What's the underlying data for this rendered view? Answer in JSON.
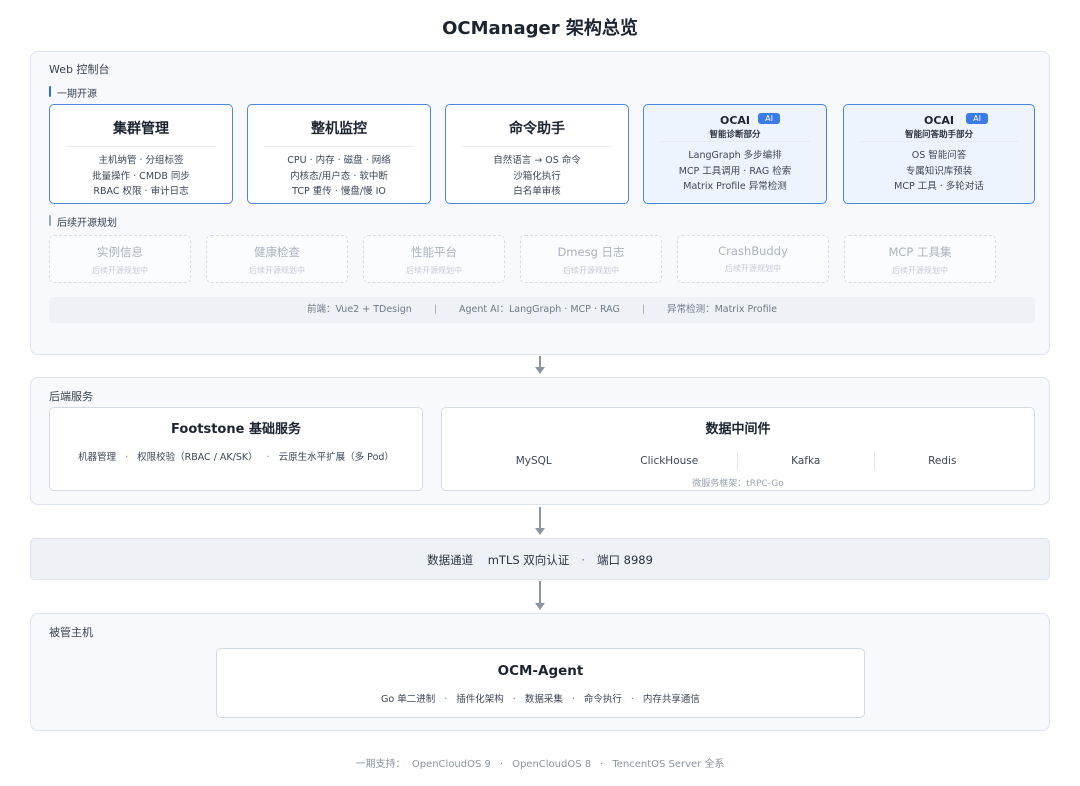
{
  "title": "OCManager 架构总览",
  "web_layer": {
    "label": "Web 控制台",
    "phase1_label": "一期开源",
    "cards": [
      {
        "title": "集群管理",
        "lines": [
          "主机纳管 · 分组标签",
          "批量操作 · CMDB 同步",
          "RBAC 权限 · 审计日志"
        ]
      },
      {
        "title": "整机监控",
        "lines": [
          "CPU · 内存 · 磁盘 · 网络",
          "内核态/用户态 · 软中断",
          "TCP 重传 · 慢盘/慢 IO"
        ]
      },
      {
        "title": "命令助手",
        "lines": [
          "自然语言 → OS 命令",
          "沙箱化执行",
          "白名单审核"
        ]
      }
    ],
    "ai_cards": [
      {
        "title": "OCAI",
        "badge": "AI",
        "subtitle": "智能诊断部分",
        "lines": [
          "LangGraph 多步编排",
          "MCP 工具调用 · RAG 检索",
          "Matrix Profile 异常检测"
        ]
      },
      {
        "title": "OCAI",
        "badge": "AI",
        "subtitle": "智能问答助手部分",
        "lines": [
          "OS 智能问答",
          "专属知识库预装",
          "MCP 工具 · 多轮对话"
        ]
      }
    ],
    "future_label": "后续开源规划",
    "future_items": [
      {
        "title": "实例信息",
        "sub": "后续开源规划中"
      },
      {
        "title": "健康检查",
        "sub": "后续开源规划中"
      },
      {
        "title": "性能平台",
        "sub": "后续开源规划中"
      },
      {
        "title": "Dmesg 日志",
        "sub": "后续开源规划中"
      },
      {
        "title": "CrashBuddy",
        "sub": "后续开源规划中"
      },
      {
        "title": "MCP 工具集",
        "sub": "后续开源规划中"
      }
    ],
    "tech_frontend": "前端：Vue2 + TDesign",
    "tech_agent": "Agent AI：LangGraph · MCP · RAG",
    "tech_anomaly": "异常检测：Matrix Profile",
    "tech_separator": "|"
  },
  "backend_layer": {
    "label": "后端服务",
    "footstone": {
      "title": "Footstone 基础服务",
      "items": [
        "机器管理",
        "权限校验（RBAC / AK/SK）",
        "云原生水平扩展（多 Pod）"
      ]
    },
    "middleware": {
      "title": "数据中间件",
      "items": [
        "MySQL",
        "ClickHouse",
        "Kafka",
        "Redis"
      ],
      "note": "微服务框架：tRPC-Go"
    }
  },
  "channel": {
    "label": "数据通道",
    "auth": "mTLS 双向认证",
    "separator": "·",
    "port": "端口 8989"
  },
  "host_layer": {
    "label": "被管主机",
    "agent": {
      "title": "OCM-Agent",
      "items": [
        "Go 单二进制",
        "插件化架构",
        "数据采集",
        "命令执行",
        "内存共享通信"
      ]
    }
  },
  "footer": {
    "prefix": "一期支持：",
    "items": [
      "OpenCloudOS 9",
      "OpenCloudOS 8",
      "TencentOS Server 全系"
    ]
  },
  "colors": {
    "accent": "#3a7be6",
    "card_border": "#4a86e0",
    "layer_bg": "#f7f9fc",
    "ai_card_bg": "#eef4fd"
  }
}
